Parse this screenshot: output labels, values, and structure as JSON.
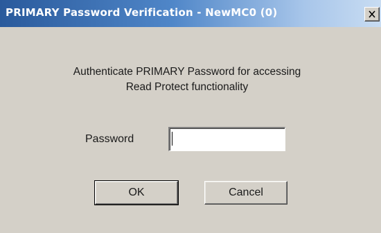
{
  "window": {
    "title": "PRIMARY Password Verification - NewMC0 (0)",
    "close_label": "X"
  },
  "message": {
    "line1": "Authenticate PRIMARY Password for accessing",
    "line2": "Read Protect functionality"
  },
  "password": {
    "label": "Password",
    "value": "",
    "placeholder": ""
  },
  "buttons": {
    "ok_label": "OK",
    "cancel_label": "Cancel"
  },
  "colors": {
    "titlebar_start": "#2a5a9c",
    "titlebar_end": "#c8dcf2",
    "dialog_background": "#d4d0c8"
  },
  "icons": {
    "close": "close-icon"
  }
}
